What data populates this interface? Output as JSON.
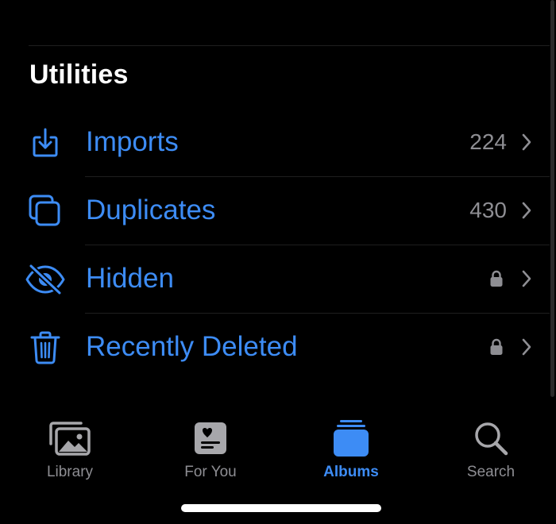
{
  "section": {
    "title": "Utilities"
  },
  "utilities": [
    {
      "label": "Imports",
      "count": "224",
      "icon": "import-icon",
      "locked": false
    },
    {
      "label": "Duplicates",
      "count": "430",
      "icon": "duplicates-icon",
      "locked": false
    },
    {
      "label": "Hidden",
      "count": "",
      "icon": "eye-slash-icon",
      "locked": true
    },
    {
      "label": "Recently Deleted",
      "count": "",
      "icon": "trash-icon",
      "locked": true
    }
  ],
  "tab_bar": {
    "tabs": [
      {
        "label": "Library",
        "icon": "photos-icon",
        "active": false
      },
      {
        "label": "For You",
        "icon": "for-you-icon",
        "active": false
      },
      {
        "label": "Albums",
        "icon": "albums-icon",
        "active": true
      },
      {
        "label": "Search",
        "icon": "magnifier-icon",
        "active": false
      }
    ]
  },
  "colors": {
    "background": "#000000",
    "accent": "#3d8cf5",
    "secondary_text": "#8e8e93",
    "inactive_icon": "#a7a7ab"
  }
}
